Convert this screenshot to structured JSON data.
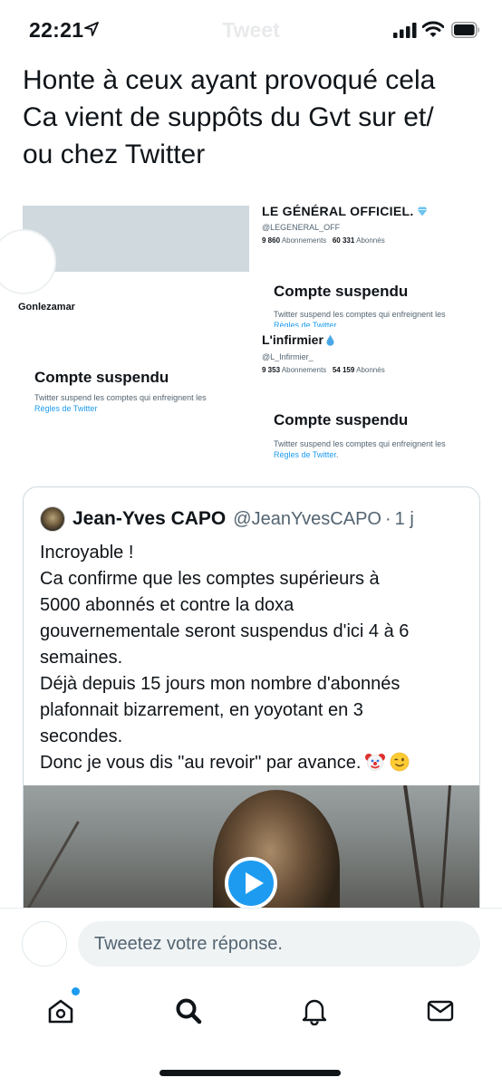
{
  "status_bar": {
    "time": "22:21",
    "location_icon": "location-arrow-icon",
    "signal_icon": "cellular-signal-icon",
    "wifi_icon": "wifi-icon",
    "battery_icon": "battery-icon"
  },
  "header": {
    "title": "Tweet"
  },
  "tweet": {
    "text": "Honte à ceux ayant provoqué cela\nCa vient de suppôts du Gvt sur et/\nou chez Twitter"
  },
  "collage": {
    "left_handle": "Gonlezamar",
    "general": {
      "name": "LE GÉNÉRAL OFFICIEL.",
      "badge_icon": "gem-icon",
      "handle": "@LEGENERAL_OFF",
      "following_count": "9 860",
      "following_label": "Abonnements",
      "followers_count": "60 331",
      "followers_label": "Abonnés"
    },
    "infirmier": {
      "name": "L'infirmier",
      "badge_icon": "droplet-icon",
      "handle": "@L_Infirmier_",
      "following_count": "9 353",
      "following_label": "Abonnements",
      "followers_count": "54 159",
      "followers_label": "Abonnés"
    },
    "suspended": {
      "title": "Compte suspendu",
      "body": "Twitter suspend les comptes qui enfreignent les",
      "link": "Règles de Twitter",
      "end": "."
    }
  },
  "quote": {
    "avatar_icon": "user-avatar",
    "name": "Jean-Yves CAPO",
    "handle": "@JeanYvesCAPO",
    "separator": "·",
    "time": "1 j",
    "lines": [
      "Incroyable !",
      "Ca confirme que les comptes supérieurs à",
      "5000 abonnés et contre la doxa",
      "gouvernementale seront suspendus d'ici 4 à 6",
      "semaines.",
      "Déjà depuis 15 jours mon nombre d'abonnés",
      "plafonnait bizarrement, en yoyotant en 3",
      "secondes.",
      "Donc je vous dis \"au revoir\" par avance."
    ],
    "emoji_icons": [
      "clown-face-icon",
      "winking-face-icon"
    ],
    "media_play_icon": "play-icon"
  },
  "reply": {
    "placeholder": "Tweetez votre réponse."
  },
  "tab_bar": {
    "tabs": [
      "home-icon",
      "search-icon",
      "notifications-bell-icon",
      "messages-envelope-icon"
    ],
    "accent": "#1d9bf0"
  },
  "colors": {
    "accent": "#1d9bf0",
    "text": "#0f1419",
    "secondary": "#536471"
  }
}
